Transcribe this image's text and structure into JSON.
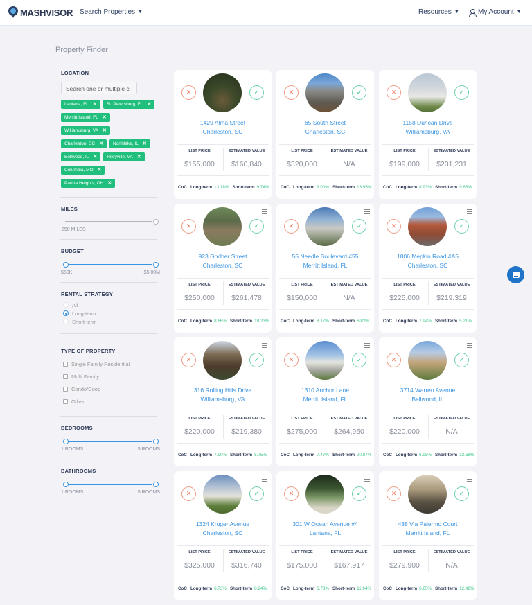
{
  "header": {
    "brand": "MASHVISOR",
    "nav_left": [
      {
        "label": "Search Properties",
        "icon": "chevron-down-icon"
      }
    ],
    "nav_right": [
      {
        "label": "Resources",
        "icon": "chevron-down-icon"
      },
      {
        "label": "My Account",
        "icon": "user-icon"
      }
    ]
  },
  "page": {
    "title": "Property Finder"
  },
  "sidebar": {
    "location": {
      "title": "LOCATION",
      "search_placeholder": "Search one or multiple ci",
      "tags": [
        "Lantana, FL",
        "St. Petersburg, FL",
        "Merritt Island, FL",
        "Williamsburg, VA",
        "Charleston, SC",
        "Northlake, IL",
        "Bellwood, IL",
        "Rileyville, VA",
        "Columbia, MO",
        "Parma Heights, OH"
      ]
    },
    "miles": {
      "title": "MILES",
      "value_label": "250 MILES",
      "value": 250
    },
    "budget": {
      "title": "BUDGET",
      "min_label": "$50K",
      "max_label": "$5.00M"
    },
    "rental_strategy": {
      "title": "RENTAL STRATEGY",
      "options": [
        "All",
        "Long-term",
        "Short-term"
      ],
      "selected": "Long-term"
    },
    "property_type": {
      "title": "TYPE OF PROPERTY",
      "options": [
        "Single Family Residential",
        "Multi Family",
        "Condo/Coop",
        "Other"
      ]
    },
    "bedrooms": {
      "title": "BEDROOMS",
      "min_label": "1 ROOMS",
      "max_label": "5 ROOMS"
    },
    "bathrooms": {
      "title": "BATHROOMS",
      "min_label": "1 ROOMS",
      "max_label": "5 ROOMS"
    }
  },
  "labels": {
    "list_price": "LIST PRICE",
    "estimated_value": "ESTIMATED VALUE",
    "coc": "CoC",
    "long_term": "Long-term",
    "short_term": "Short-term",
    "reject": "✕",
    "accept": "✓"
  },
  "colors": {
    "accent": "#3a93e0",
    "tag_green": "#20bf7e",
    "reject": "#f07a5e",
    "accept": "#3cc58b",
    "chat": "#1f73c8"
  },
  "properties": [
    {
      "street": "1429 Alma Street",
      "city": "Charleston, SC",
      "list_price": "$155,000",
      "estimated_value": "$160,840",
      "coc_long": "13.18%",
      "coc_short": "9.74%"
    },
    {
      "street": "65 South Street",
      "city": "Charleston, SC",
      "list_price": "$320,000",
      "estimated_value": "N/A",
      "coc_long": "9.00%",
      "coc_short": "13.95%"
    },
    {
      "street": "1158 Duncan Drive",
      "city": "Williamsburg, VA",
      "list_price": "$199,000",
      "estimated_value": "$201,231",
      "coc_long": "8.93%",
      "coc_short": "9.86%"
    },
    {
      "street": "923 Godber Street",
      "city": "Charleston, SC",
      "list_price": "$250,000",
      "estimated_value": "$261,478",
      "coc_long": "8.66%",
      "coc_short": "10.23%"
    },
    {
      "street": "55 Needle Boulevard #55",
      "city": "Merritt Island, FL",
      "list_price": "$150,000",
      "estimated_value": "N/A",
      "coc_long": "8.17%",
      "coc_short": "6.82%"
    },
    {
      "street": "1806 Mepkin Road #A5",
      "city": "Charleston, SC",
      "list_price": "$225,000",
      "estimated_value": "$219,319",
      "coc_long": "7.94%",
      "coc_short": "5.21%"
    },
    {
      "street": "316 Rolling Hills Drive",
      "city": "Williamsburg, VA",
      "list_price": "$220,000",
      "estimated_value": "$219,380",
      "coc_long": "7.90%",
      "coc_short": "8.75%"
    },
    {
      "street": "1310 Anchor Lane",
      "city": "Merritt Island, FL",
      "list_price": "$275,000",
      "estimated_value": "$264,950",
      "coc_long": "7.47%",
      "coc_short": "20.87%"
    },
    {
      "street": "3714 Warren Avenue",
      "city": "Bellwood, IL",
      "list_price": "$220,000",
      "estimated_value": "N/A",
      "coc_long": "6.98%",
      "coc_short": "12.68%"
    },
    {
      "street": "1324 Kruger Avenue",
      "city": "Charleston, SC",
      "list_price": "$325,000",
      "estimated_value": "$316,740",
      "coc_long": "6.73%",
      "coc_short": "8.24%"
    },
    {
      "street": "301 W Ocean Avenue #4",
      "city": "Lantana, FL",
      "list_price": "$175,000",
      "estimated_value": "$167,917",
      "coc_long": "6.73%",
      "coc_short": "11.94%"
    },
    {
      "street": "438 Via Palermo Court",
      "city": "Merritt Island, FL",
      "list_price": "$279,900",
      "estimated_value": "N/A",
      "coc_long": "6.65%",
      "coc_short": "12.42%"
    }
  ]
}
